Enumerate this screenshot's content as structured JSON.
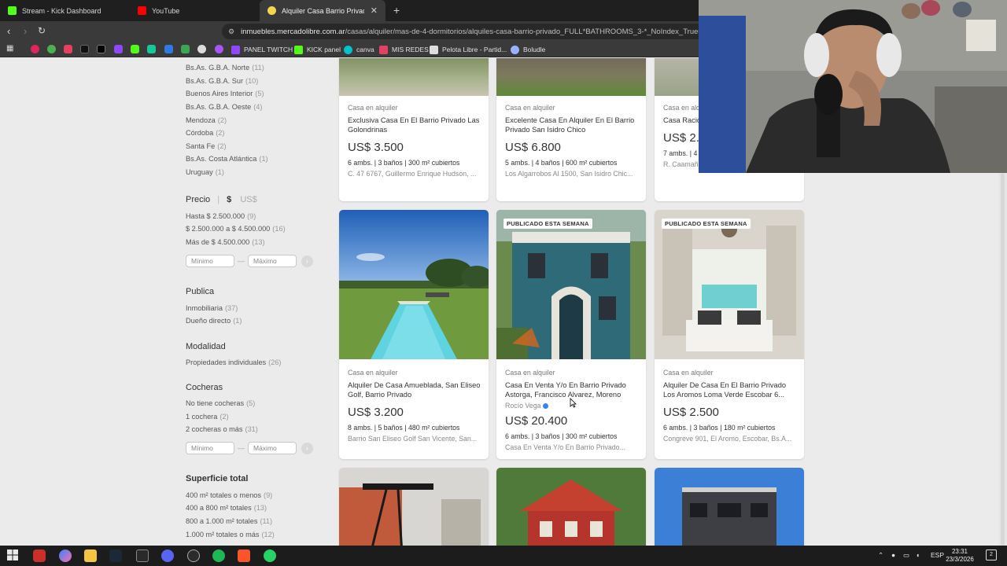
{
  "browser": {
    "tabs": [
      {
        "label": "Stream - Kick Dashboard",
        "color": "#53fc18"
      },
      {
        "label": "YouTube",
        "color": "#ff0000"
      },
      {
        "label": "Alquiler Casa Barrio Privado | Me",
        "color": "#f2d64b"
      }
    ],
    "url_domain": "inmuebles.mercadolibre.com.ar",
    "url_path": "/casas/alquiler/mas-de-4-dormitorios/alquiles-casa-barrio-privado_FULL*BATHROOMS_3-*_NoIndex_True#app",
    "bookmarks": [
      {
        "label": "PANEL TWITCH",
        "color": "#9146ff"
      },
      {
        "label": "KICK panel",
        "color": "#53fc18"
      },
      {
        "label": "canva",
        "color": "#00c4cc"
      },
      {
        "label": "MIS REDES",
        "color": "#e4405f"
      },
      {
        "label": "Pelota Libre - Partid...",
        "color": "#dddddd"
      },
      {
        "label": "Boludle",
        "color": "#9ab0ff"
      }
    ]
  },
  "filters": {
    "locations": [
      {
        "name": "Bs.As. G.B.A. Norte",
        "count": "(11)"
      },
      {
        "name": "Bs.As. G.B.A. Sur",
        "count": "(10)"
      },
      {
        "name": "Buenos Aires Interior",
        "count": "(5)"
      },
      {
        "name": "Bs.As. G.B.A. Oeste",
        "count": "(4)"
      },
      {
        "name": "Mendoza",
        "count": "(2)"
      },
      {
        "name": "Córdoba",
        "count": "(2)"
      },
      {
        "name": "Santa Fe",
        "count": "(2)"
      },
      {
        "name": "Bs.As. Costa Atlántica",
        "count": "(1)"
      },
      {
        "name": "Uruguay",
        "count": "(1)"
      }
    ],
    "price": {
      "title": "Precio",
      "currency_ars": "$",
      "currency_usd": "US$",
      "options": [
        {
          "name": "Hasta $ 2.500.000",
          "count": "(9)"
        },
        {
          "name": "$ 2.500.000 a $ 4.500.000",
          "count": "(16)"
        },
        {
          "name": "Más de $ 4.500.000",
          "count": "(13)"
        }
      ],
      "min_placeholder": "Mínimo",
      "max_placeholder": "Máximo"
    },
    "publica": {
      "title": "Publica",
      "options": [
        {
          "name": "Inmobiliaria",
          "count": "(37)"
        },
        {
          "name": "Dueño directo",
          "count": "(1)"
        }
      ]
    },
    "modalidad": {
      "title": "Modalidad",
      "options": [
        {
          "name": "Propiedades individuales",
          "count": "(26)"
        }
      ]
    },
    "cocheras": {
      "title": "Cocheras",
      "options": [
        {
          "name": "No tiene cocheras",
          "count": "(5)"
        },
        {
          "name": "1 cochera",
          "count": "(2)"
        },
        {
          "name": "2 cocheras o más",
          "count": "(31)"
        }
      ],
      "min_placeholder": "Mínimo",
      "max_placeholder": "Máximo"
    },
    "superficie": {
      "title": "Superficie total",
      "options": [
        {
          "name": "400 m² totales o menos",
          "count": "(9)"
        },
        {
          "name": "400 a 800 m² totales",
          "count": "(13)"
        },
        {
          "name": "800 a 1.000 m² totales",
          "count": "(11)"
        },
        {
          "name": "1.000 m² totales o más",
          "count": "(12)"
        }
      ]
    }
  },
  "listings": [
    {
      "type": "Casa en alquiler",
      "title": "Exclusiva Casa En El Barrio Privado Las Golondrinas",
      "price": "US$ 3.500",
      "attrs": "6 ambs. | 3 baños | 300 m² cubiertos",
      "location": "C. 47 6767, Guillermo Enrique Hudson, ..."
    },
    {
      "type": "Casa en alquiler",
      "title": "Excelente Casa En Alquiler En El Barrio Privado San Isidro Chico",
      "price": "US$ 6.800",
      "attrs": "5 ambs. | 4 baños | 600 m² cubiertos",
      "location": "Los Algarrobos Al 1500, San Isidro Chic..."
    },
    {
      "type": "Casa en alq",
      "title": "Casa Racio Barrio Priva",
      "price": "US$ 2.",
      "attrs": "7 ambs. | 4",
      "location": "R. Caamaño 1"
    },
    {
      "type": "Casa en alquiler",
      "title": "Alquiler De Casa Amueblada, San Eliseo Golf, Barrio Privado",
      "price": "US$ 3.200",
      "attrs": "8 ambs. | 5 baños | 480 m² cubiertos",
      "location": "Barrio San Eliseo Golf San Vicente, San..."
    },
    {
      "badge": "PUBLICADO ESTA SEMANA",
      "type": "Casa en alquiler",
      "title": "Casa En Venta Y/o En Barrio Privado Astorga, Francisco Alvarez, Moreno",
      "seller": "Rocío Vega",
      "price": "US$ 20.400",
      "attrs": "6 ambs. | 3 baños | 300 m² cubiertos",
      "location": "Casa En Venta Y/o En Barrio Privado..."
    },
    {
      "badge": "PUBLICADO ESTA SEMANA",
      "type": "Casa en alquiler",
      "title": "Alquiler De Casa En El Barrio Privado Los Aromos Loma Verde Escobar 6...",
      "price": "US$ 2.500",
      "attrs": "6 ambs. | 3 baños | 180 m² cubiertos",
      "location": "Congreve 901, El Aromo, Escobar, Bs.A..."
    }
  ],
  "taskbar": {
    "lang": "ESP",
    "time": "23:31",
    "date": "23/3/2026",
    "notif_count": "2"
  }
}
